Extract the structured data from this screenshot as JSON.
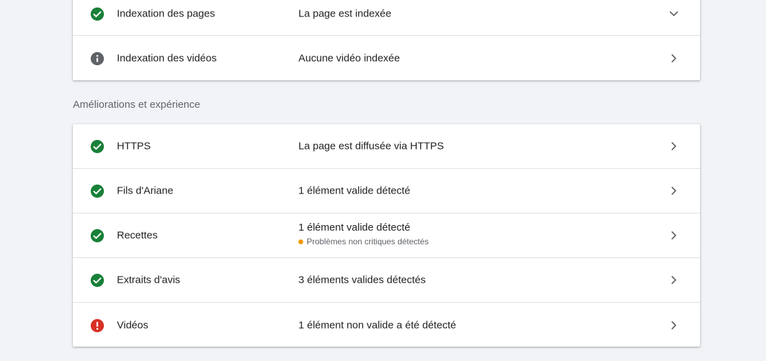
{
  "indexing": {
    "rows": [
      {
        "label": "Indexation des pages",
        "value": "La page est indexée",
        "status": "valid",
        "chevron": "chevron-down-icon"
      },
      {
        "label": "Indexation des vidéos",
        "value": "Aucune vidéo indexée",
        "status": "info",
        "chevron": "chevron-right-icon"
      }
    ]
  },
  "enhancements": {
    "heading": "Améliorations et expérience",
    "rows": [
      {
        "label": "HTTPS",
        "value": "La page est diffusée via HTTPS",
        "status": "valid"
      },
      {
        "label": "Fils d'Ariane",
        "value": "1 élément valide détecté",
        "status": "valid"
      },
      {
        "label": "Recettes",
        "value": "1 élément valide détecté",
        "sub": "Problèmes non critiques détectés",
        "status": "valid"
      },
      {
        "label": "Extraits d'avis",
        "value": "3 éléments valides détectés",
        "status": "valid"
      },
      {
        "label": "Vidéos",
        "value": "1 élément non valide a été détecté",
        "status": "error"
      }
    ]
  },
  "colors": {
    "valid": "#188038",
    "info": "#5f6368",
    "error": "#d93025",
    "warning": "#f29900"
  }
}
